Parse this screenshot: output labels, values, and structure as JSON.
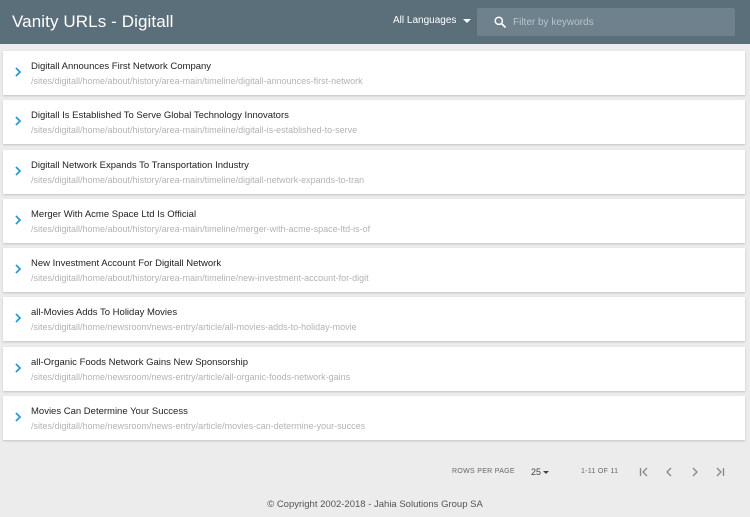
{
  "header": {
    "title": "Vanity URLs - Digitall",
    "language_label": "All Languages",
    "search_placeholder": "Filter by keywords"
  },
  "items": [
    {
      "name": "Digitall Announces First Network Company",
      "url": "/sites/digitall/home/about/history/area-main/timeline/digitall-announces-first-network"
    },
    {
      "name": "Digitall Is Established To Serve Global Technology Innovators",
      "url": "/sites/digitall/home/about/history/area-main/timeline/digitall-is-established-to-serve"
    },
    {
      "name": "Digitall Network Expands To Transportation Industry",
      "url": "/sites/digitall/home/about/history/area-main/timeline/digitall-network-expands-to-tran"
    },
    {
      "name": "Merger With Acme Space Ltd Is Official",
      "url": "/sites/digitall/home/about/history/area-main/timeline/merger-with-acme-space-ltd-is-of"
    },
    {
      "name": "New Investment Account For Digitall Network",
      "url": "/sites/digitall/home/about/history/area-main/timeline/new-investment-account-for-digit"
    },
    {
      "name": "all-Movies Adds To Holiday Movies",
      "url": "/sites/digitall/home/newsroom/news-entry/article/all-movies-adds-to-holiday-movie"
    },
    {
      "name": "all-Organic Foods Network Gains New Sponsorship",
      "url": "/sites/digitall/home/newsroom/news-entry/article/all-organic-foods-network-gains"
    },
    {
      "name": "Movies Can Determine Your Success",
      "url": "/sites/digitall/home/newsroom/news-entry/article/movies-can-determine-your-succes"
    }
  ],
  "pagination": {
    "rows_per_page_label": "ROWS PER PAGE",
    "rows_per_page": "25",
    "range": "1-11 OF 11"
  },
  "footer": {
    "copyright": "© Copyright 2002-2018 - Jahia Solutions Group SA"
  },
  "colors": {
    "header": "#5b6f7b",
    "chevron": "#2a9ad4"
  }
}
